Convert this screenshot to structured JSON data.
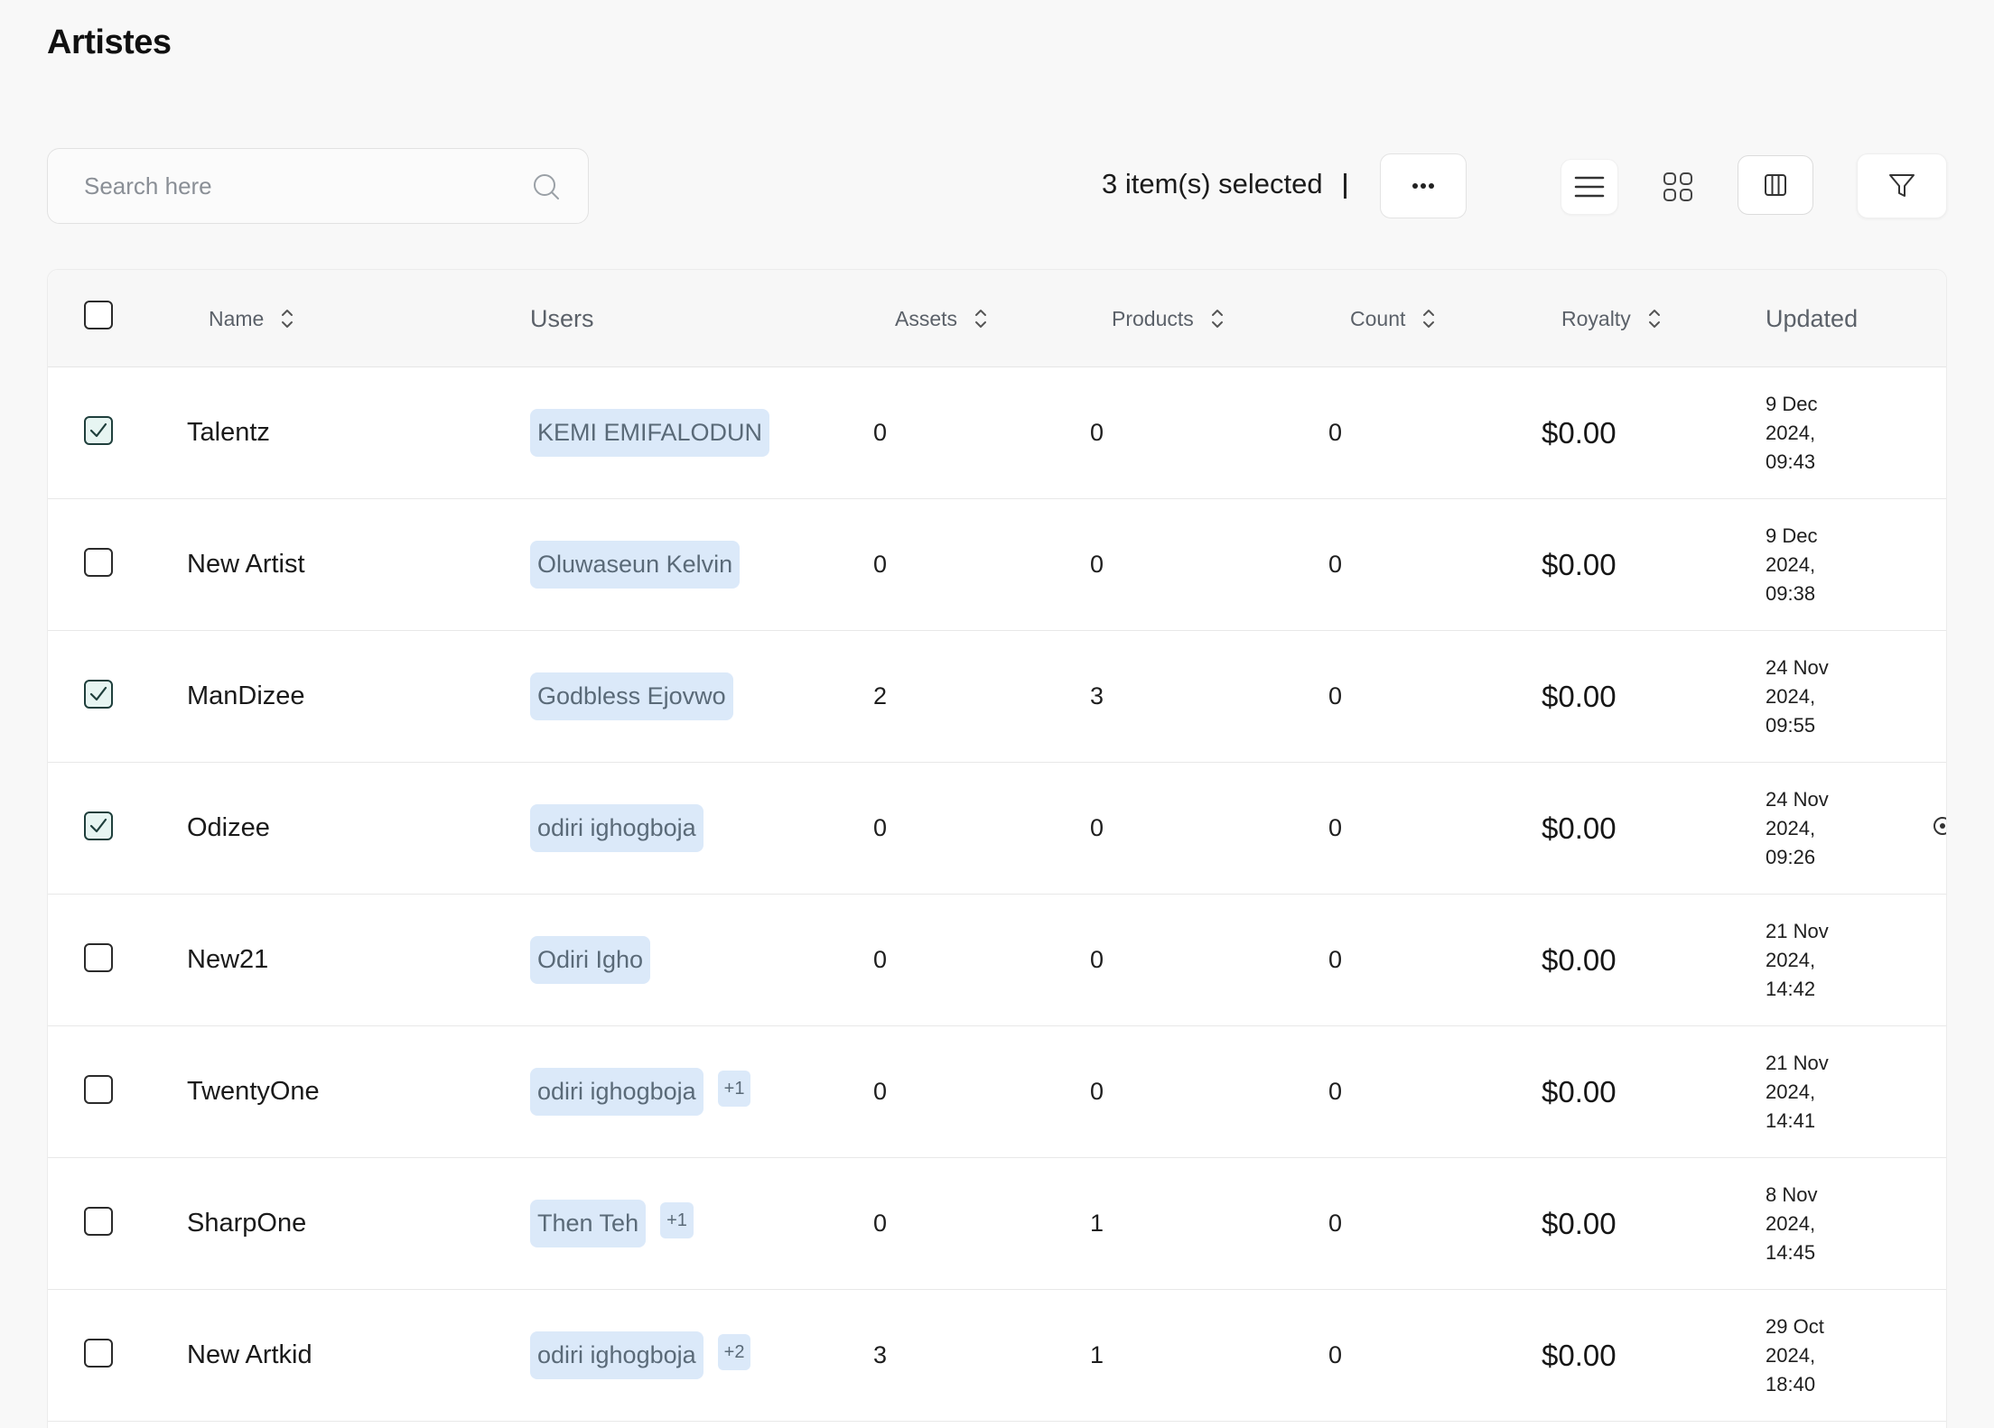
{
  "page": {
    "title": "Artistes"
  },
  "toolbar": {
    "search_placeholder": "Search here",
    "selected_text": "3 item(s) selected",
    "separator": "|",
    "more_label": "···"
  },
  "table": {
    "columns": {
      "name": "Name",
      "users": "Users",
      "assets": "Assets",
      "products": "Products",
      "count": "Count",
      "royalty": "Royalty",
      "updated": "Updated"
    },
    "rows": [
      {
        "selected": true,
        "name": "Talentz",
        "user": "KEMI EMIFALODUN",
        "extra": "",
        "assets": "0",
        "products": "0",
        "count": "0",
        "royalty": "$0.00",
        "updated": [
          "9 Dec",
          "2024,",
          "09:43"
        ]
      },
      {
        "selected": false,
        "name": "New Artist",
        "user": "Oluwaseun Kelvin",
        "extra": "",
        "assets": "0",
        "products": "0",
        "count": "0",
        "royalty": "$0.00",
        "updated": [
          "9 Dec",
          "2024,",
          "09:38"
        ]
      },
      {
        "selected": true,
        "name": "ManDizee",
        "user": "Godbless Ejovwo",
        "extra": "",
        "assets": "2",
        "products": "3",
        "count": "0",
        "royalty": "$0.00",
        "updated": [
          "24 Nov",
          "2024,",
          "09:55"
        ]
      },
      {
        "selected": true,
        "name": "Odizee",
        "user": "odiri ighogboja",
        "extra": "",
        "assets": "0",
        "products": "0",
        "count": "0",
        "royalty": "$0.00",
        "updated": [
          "24 Nov",
          "2024,",
          "09:26"
        ]
      },
      {
        "selected": false,
        "name": "New21",
        "user": "Odiri Igho",
        "extra": "",
        "assets": "0",
        "products": "0",
        "count": "0",
        "royalty": "$0.00",
        "updated": [
          "21 Nov",
          "2024,",
          "14:42"
        ]
      },
      {
        "selected": false,
        "name": "TwentyOne",
        "user": "odiri ighogboja",
        "extra": "+1",
        "assets": "0",
        "products": "0",
        "count": "0",
        "royalty": "$0.00",
        "updated": [
          "21 Nov",
          "2024,",
          "14:41"
        ]
      },
      {
        "selected": false,
        "name": "SharpOne",
        "user": "Then Teh",
        "extra": "+1",
        "assets": "0",
        "products": "1",
        "count": "0",
        "royalty": "$0.00",
        "updated": [
          "8 Nov",
          "2024,",
          "14:45"
        ]
      },
      {
        "selected": false,
        "name": "New Artkid",
        "user": "odiri ighogboja",
        "extra": "+2",
        "assets": "3",
        "products": "1",
        "count": "0",
        "royalty": "$0.00",
        "updated": [
          "29 Oct",
          "2024,",
          "18:40"
        ]
      }
    ]
  },
  "colors": {
    "background": "#f8f8f8",
    "chip_bg": "#dbe9f9",
    "chip_text": "#5a6a78",
    "check_color": "#1f3f3c"
  }
}
